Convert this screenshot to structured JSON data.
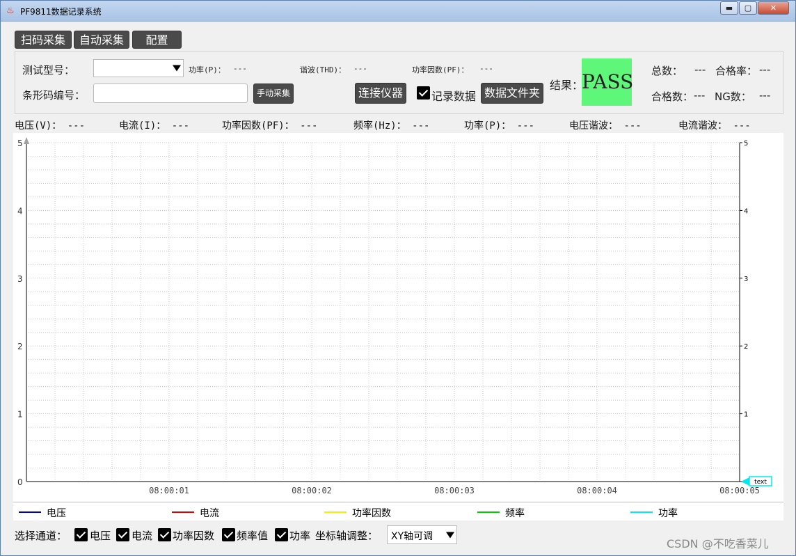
{
  "window": {
    "title": "PF9811数据记录系统",
    "min": "▬",
    "max": "▢",
    "close": "✕"
  },
  "tabs": [
    "扫码采集",
    "自动采集",
    "配置"
  ],
  "panel": {
    "model_label": "测试型号：",
    "model_value": "",
    "barcode_label": "条形码编号：",
    "barcode_value": "",
    "power_label": "功率(P)：",
    "power_value": "---",
    "thd_label": "谐波(THD)：",
    "thd_value": "---",
    "pf_label": "功率因数(PF)：",
    "pf_value": "---",
    "manual_btn": "手动采集",
    "connect_btn": "连接仪器",
    "record_label": "记录数据",
    "record_checked": true,
    "folder_btn": "数据文件夹",
    "result_label": "结果：",
    "result_value": "PASS",
    "result_color": "#5ef77a",
    "total_label": "总数：",
    "total_value": "---",
    "passrate_label": "合格率：",
    "passrate_value": "---",
    "passcount_label": "合格数：",
    "passcount_value": "---",
    "ngcount_label": "NG数：",
    "ngcount_value": "---"
  },
  "measurements": [
    {
      "label": "电压(V)：",
      "value": "---"
    },
    {
      "label": "电流(I)：",
      "value": "---"
    },
    {
      "label": "功率因数(PF)：",
      "value": "---"
    },
    {
      "label": "频率(Hz)：",
      "value": "---"
    },
    {
      "label": "功率(P)：",
      "value": "---"
    },
    {
      "label": "电压谐波：",
      "value": "---"
    },
    {
      "label": "电流谐波：",
      "value": "---"
    }
  ],
  "chart_data": {
    "type": "line",
    "title": "",
    "xlabel": "",
    "ylabel": "",
    "x_ticks": [
      "08:00:01",
      "08:00:02",
      "08:00:03",
      "08:00:04",
      "08:00:05"
    ],
    "y_ticks": [
      "0",
      "1",
      "2",
      "3",
      "4",
      "5"
    ],
    "y2_ticks": [
      "1",
      "2",
      "3",
      "4",
      "5"
    ],
    "ylim": [
      0,
      5
    ],
    "grid": true,
    "marker_text": "text",
    "series": [
      {
        "name": "电压",
        "color": "#0000cc",
        "values": []
      },
      {
        "name": "电流",
        "color": "#e00000",
        "values": []
      },
      {
        "name": "功率因数",
        "color": "#f0f000",
        "values": []
      },
      {
        "name": "频率",
        "color": "#00d000",
        "values": []
      },
      {
        "name": "功率",
        "color": "#00e8f0",
        "values": []
      }
    ]
  },
  "channels": {
    "label": "选择通道：",
    "items": [
      {
        "label": "电压",
        "checked": true
      },
      {
        "label": "电流",
        "checked": true
      },
      {
        "label": "功率因数",
        "checked": true
      },
      {
        "label": "频率值",
        "checked": true
      },
      {
        "label": "功率",
        "checked": true
      }
    ],
    "axis_label": "坐标轴调整：",
    "axis_value": "XY轴可调"
  },
  "watermark": "CSDN @不吃香菜儿"
}
